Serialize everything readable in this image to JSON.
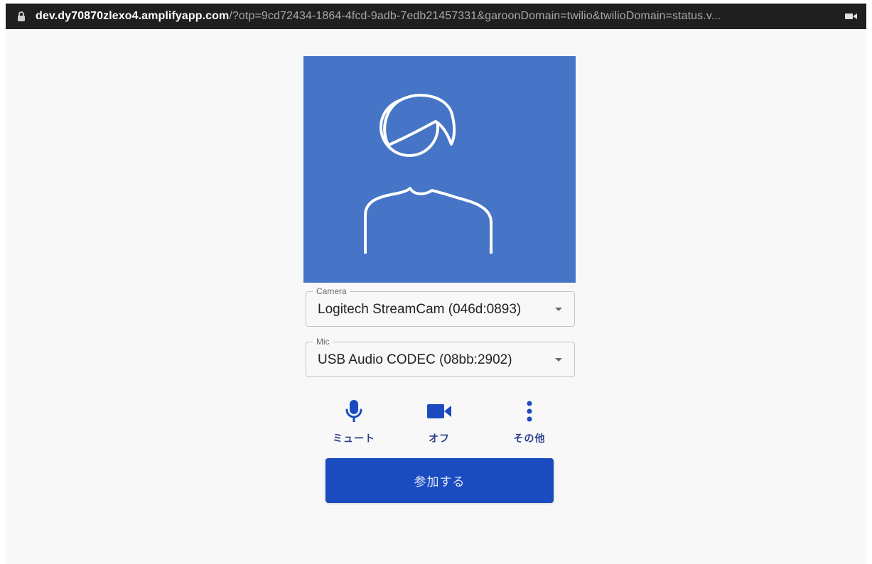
{
  "browser": {
    "url_host": "dev.dy70870zlexo4.amplifyapp.com",
    "url_rest": "/?otp=9cd72434-1864-4fcd-9adb-7edb21457331&garoonDomain=twilio&twilioDomain=status.v...",
    "lock_icon": "lock-icon",
    "camera_indicator_icon": "video-camera-icon"
  },
  "preview": {
    "avatar_icon": "person-avatar-icon",
    "background_color": "#4674c6"
  },
  "camera_select": {
    "label": "Camera",
    "value": "Logitech StreamCam (046d:0893)"
  },
  "mic_select": {
    "label": "Mic",
    "value": "USB Audio CODEC (08bb:2902)"
  },
  "controls": {
    "mute": {
      "label": "ミュート",
      "icon": "microphone-icon"
    },
    "video": {
      "label": "オフ",
      "icon": "video-camera-icon"
    },
    "more": {
      "label": "その他",
      "icon": "more-vertical-icon"
    }
  },
  "join_button": {
    "label": "参加する",
    "color": "#1a4bbf"
  },
  "colors": {
    "accent": "#1a4bbf",
    "control_label": "#2d3e8c"
  }
}
